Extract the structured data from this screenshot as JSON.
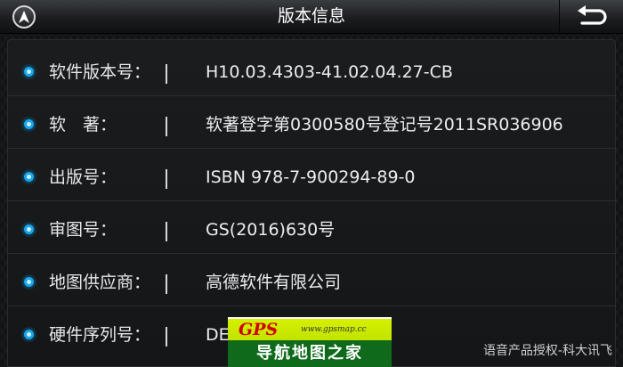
{
  "header": {
    "title": "版本信息"
  },
  "rows": [
    {
      "label": "软件版本号：",
      "value": "H10.03.4303-41.02.04.27-CB"
    },
    {
      "label": "软　著：",
      "value": "软著登字第0300580号登记号2011SR036906"
    },
    {
      "label": "出版号：",
      "value": "ISBN 978-7-900294-89-0"
    },
    {
      "label": "审图号：",
      "value": "GS(2016)630号"
    },
    {
      "label": "地图供应商：",
      "value": "高德软件有限公司"
    },
    {
      "label": "硬件序列号：",
      "value": "DE"
    }
  ],
  "watermark": {
    "logo": "GPS",
    "site": "www.gpsmap.cc",
    "band": "导航地图之家"
  },
  "footer": {
    "credit": "语音产品授权-科大讯飞"
  },
  "colors": {
    "bullet": "#1aa6e8",
    "text": "#ededed",
    "watermark_green": "#0f6a1c",
    "watermark_yellow": "#d6f000"
  },
  "icons": {
    "nav": "navigation-arrow-icon",
    "back": "back-arrow-icon"
  }
}
